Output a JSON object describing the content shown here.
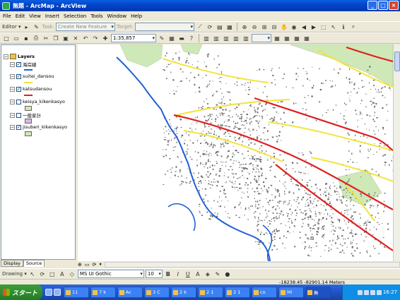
{
  "window": {
    "title": "無題 - ArcMap - ArcView"
  },
  "menu": [
    "File",
    "Edit",
    "View",
    "Insert",
    "Selection",
    "Tools",
    "Window",
    "Help"
  ],
  "editor_toolbar": {
    "editor_label": "Editor ▾",
    "task_label": "Task:",
    "task_value": "Create New Feature",
    "target_label": "Target:",
    "target_value": ""
  },
  "standard_toolbar": {
    "scale": "1:35,857"
  },
  "toc": {
    "root": "Layers",
    "layers": [
      {
        "name": "海岸線",
        "checked": true,
        "symbol": "line",
        "color": "#1f5fd6"
      },
      {
        "name": "suitei_dansou",
        "checked": true,
        "symbol": "line",
        "color": "#f1e43a"
      },
      {
        "name": "katsudansou",
        "checked": true,
        "symbol": "line",
        "color": "#e02020"
      },
      {
        "name": "keisya_kikenkasyo",
        "checked": false,
        "symbol": "box",
        "color": "#cfe8b8"
      },
      {
        "name": "一般家計",
        "checked": false,
        "symbol": "box",
        "color": "#d6b8e8"
      },
      {
        "name": "jisuberi_kikenkasyo",
        "checked": true,
        "symbol": "box",
        "color": "#cfe8b8"
      }
    ],
    "tabs": [
      "Display",
      "Source"
    ]
  },
  "drawing_toolbar": {
    "drawing_label": "Drawing ▾",
    "font": "MS UI Gothic",
    "size": "10",
    "bold": "B",
    "italic": "I",
    "underline": "U",
    "text_tool": "A"
  },
  "status": {
    "coordinates": "-18238.45  -82901.14 Meters"
  },
  "taskbar": {
    "start": "スタート",
    "tasks": [
      "11",
      "7 k",
      "Ac",
      "3 C",
      "2 k",
      "2 1",
      "2 1",
      "co",
      "Mi",
      "無"
    ],
    "clock": "16:27"
  },
  "map_colors": {
    "coast": "#1f5fd6",
    "active_fault": "#e02020",
    "inferred_fault": "#f1e43a",
    "landslide_area": "#cfe8b8",
    "buildings": "#6b6b6b"
  }
}
